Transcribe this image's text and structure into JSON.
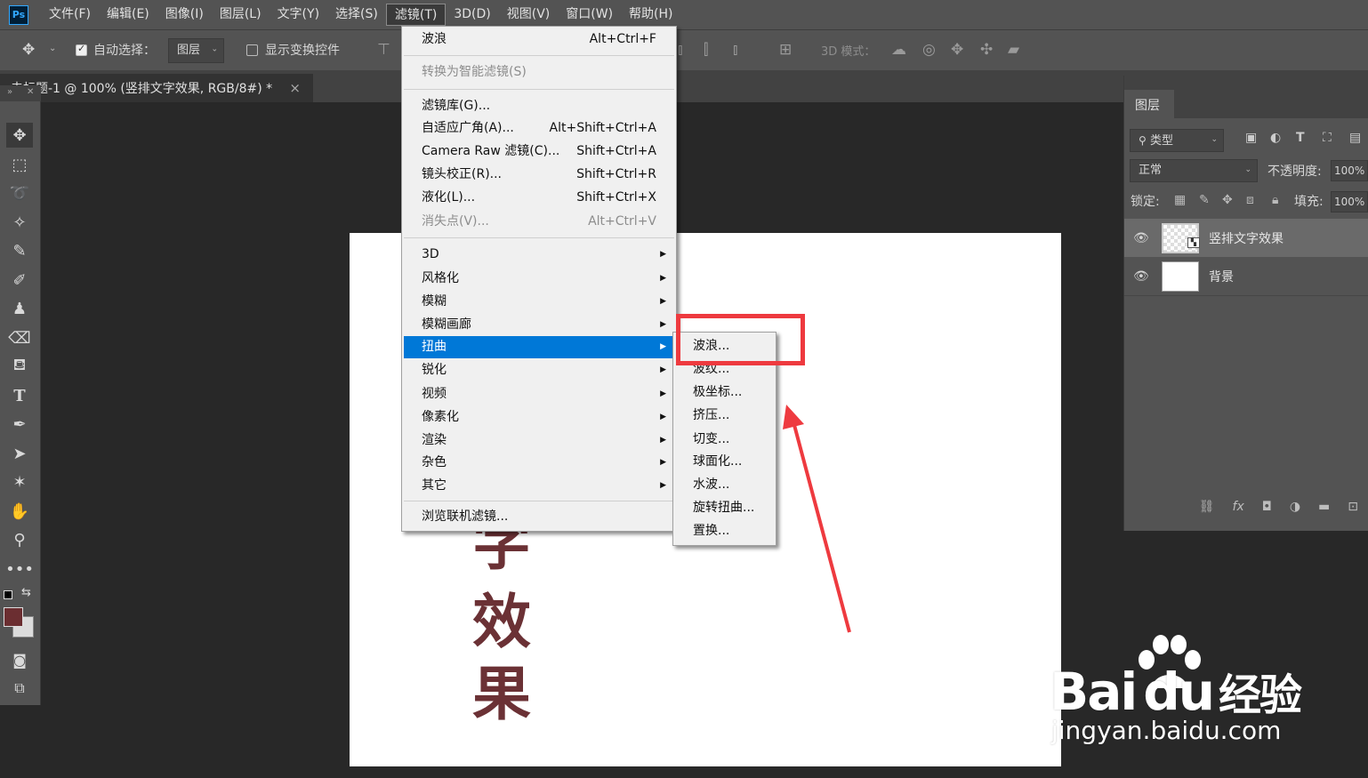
{
  "menubar": {
    "logo": "Ps",
    "items": [
      "文件(F)",
      "编辑(E)",
      "图像(I)",
      "图层(L)",
      "文字(Y)",
      "选择(S)",
      "滤镜(T)",
      "3D(D)",
      "视图(V)",
      "窗口(W)",
      "帮助(H)"
    ],
    "active": "滤镜(T)"
  },
  "options": {
    "auto_select_label": "自动选择：",
    "auto_select_checked": true,
    "auto_select_value": "图层",
    "show_transform_label": "显示变换控件",
    "mode_3d_label": "3D 模式："
  },
  "document": {
    "tab_title": "未标题-1 @ 100% (竖排文字效果, RGB/8#) *",
    "tab_close": "×",
    "canvas_chars": [
      "字",
      "效",
      "果"
    ]
  },
  "filter_menu": {
    "top": [
      {
        "label": "波浪",
        "shortcut": "Alt+Ctrl+F"
      }
    ],
    "convert": {
      "label": "转换为智能滤镜(S)",
      "disabled": true
    },
    "group2": [
      {
        "label": "滤镜库(G)...",
        "shortcut": ""
      },
      {
        "label": "自适应广角(A)...",
        "shortcut": "Alt+Shift+Ctrl+A"
      },
      {
        "label": "Camera Raw 滤镜(C)...",
        "shortcut": "Shift+Ctrl+A"
      },
      {
        "label": "镜头校正(R)...",
        "shortcut": "Shift+Ctrl+R"
      },
      {
        "label": "液化(L)...",
        "shortcut": "Shift+Ctrl+X"
      },
      {
        "label": "消失点(V)...",
        "shortcut": "Alt+Ctrl+V",
        "disabled": true
      }
    ],
    "submenus": [
      "3D",
      "风格化",
      "模糊",
      "模糊画廊",
      "扭曲",
      "锐化",
      "视频",
      "像素化",
      "渲染",
      "杂色",
      "其它"
    ],
    "highlighted": "扭曲",
    "browse": "浏览联机滤镜..."
  },
  "distort_submenu": {
    "items": [
      "波浪...",
      "波纹...",
      "极坐标...",
      "挤压...",
      "切变...",
      "球面化...",
      "水波...",
      "旋转扭曲...",
      "置换..."
    ],
    "boxed": "波浪..."
  },
  "layers_panel": {
    "tab_label": "图层",
    "filter_kind": "类型",
    "blend_mode": "正常",
    "opacity_label": "不透明度:",
    "opacity_value": "100%",
    "lock_label": "锁定:",
    "fill_label": "填充:",
    "fill_value": "100%",
    "layers": [
      {
        "name": "竖排文字效果",
        "selected": true,
        "type": "smart-object"
      },
      {
        "name": "背景",
        "selected": false,
        "type": "background"
      }
    ]
  },
  "colors": {
    "foreground": "#6b2e31",
    "background": "#dcdcdc",
    "annotation": "#ee3a3f",
    "menu_highlight": "#0078d7"
  },
  "watermark": {
    "brand": "Bai",
    "brand2": "du",
    "brand_cn": "经验",
    "site": "jingyan.baidu.com"
  }
}
